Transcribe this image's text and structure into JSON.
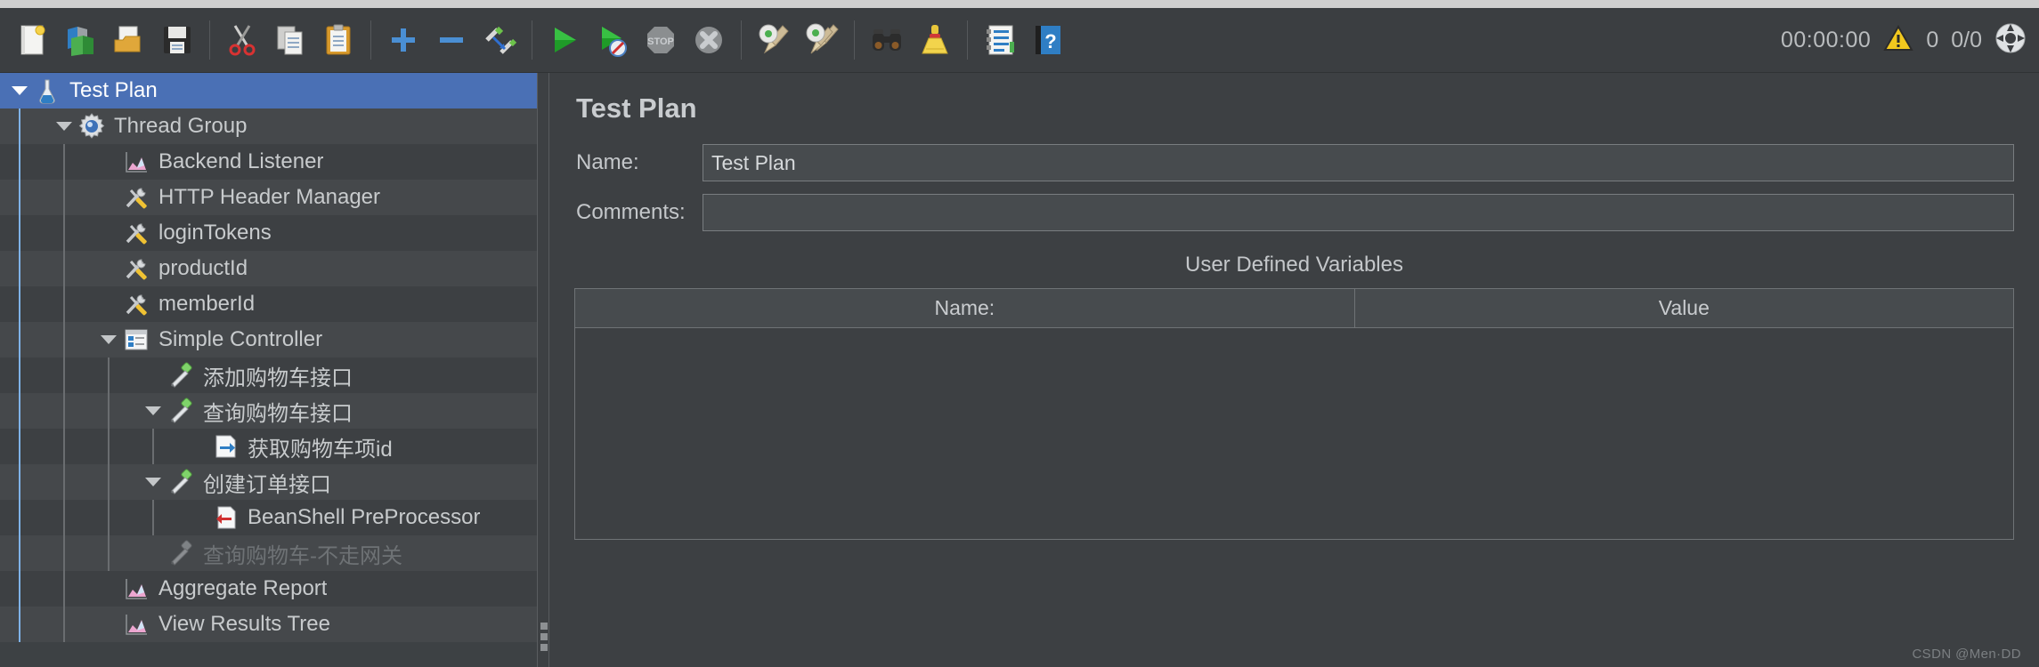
{
  "toolbar": {
    "buttons": [
      {
        "name": "new-button",
        "icon": "new-document-icon",
        "label": "New"
      },
      {
        "name": "templates-button",
        "icon": "templates-icon",
        "label": "Templates"
      },
      {
        "name": "open-button",
        "icon": "open-folder-icon",
        "label": "Open"
      },
      {
        "name": "save-button",
        "icon": "save-floppy-icon",
        "label": "Save Test Plan"
      },
      {
        "name": "cut-button",
        "icon": "scissors-icon",
        "label": "Cut"
      },
      {
        "name": "copy-button",
        "icon": "copy-pages-icon",
        "label": "Copy"
      },
      {
        "name": "paste-button",
        "icon": "clipboard-icon",
        "label": "Paste"
      },
      {
        "name": "expand-all-button",
        "icon": "plus-icon",
        "label": "Expand All"
      },
      {
        "name": "collapse-all-button",
        "icon": "minus-icon",
        "label": "Collapse All"
      },
      {
        "name": "toggle-button",
        "icon": "toggle-pencil-icon",
        "label": "Toggle"
      },
      {
        "name": "start-button",
        "icon": "green-play-icon",
        "label": "Start"
      },
      {
        "name": "start-no-pauses-button",
        "icon": "green-play-no-timers-icon",
        "label": "Start no pauses"
      },
      {
        "name": "stop-button",
        "icon": "stop-sign-icon",
        "label": "Stop"
      },
      {
        "name": "shutdown-button",
        "icon": "shutdown-x-icon",
        "label": "Shutdown"
      },
      {
        "name": "clear-button",
        "icon": "gear-broom-icon",
        "label": "Clear"
      },
      {
        "name": "clear-all-button",
        "icon": "gear-brooms-icon",
        "label": "Clear All"
      },
      {
        "name": "search-button",
        "icon": "binoculars-icon",
        "label": "Search"
      },
      {
        "name": "reset-search-button",
        "icon": "yellow-broom-icon",
        "label": "Reset Search"
      },
      {
        "name": "function-helper-button",
        "icon": "list-report-icon",
        "label": "Function Helper Dialog"
      },
      {
        "name": "help-button",
        "icon": "blue-help-book-icon",
        "label": "Help"
      }
    ],
    "status": {
      "timer": "00:00:00",
      "warning_icon": "warning-triangle-icon",
      "warning_count": "0",
      "threads": "0/0",
      "connection_icon": "connection-status-icon"
    }
  },
  "tree": {
    "items": [
      {
        "label": "Test Plan",
        "depth": 0,
        "icon": "test-plan-icon",
        "twisty": "down",
        "selected": true,
        "disabled": false
      },
      {
        "label": "Thread Group",
        "depth": 1,
        "icon": "thread-group-gear-icon",
        "twisty": "down",
        "selected": false,
        "disabled": false
      },
      {
        "label": "Backend Listener",
        "depth": 2,
        "icon": "listener-chart-icon",
        "twisty": "none",
        "selected": false,
        "disabled": false
      },
      {
        "label": "HTTP Header Manager",
        "depth": 2,
        "icon": "config-tools-icon",
        "twisty": "none",
        "selected": false,
        "disabled": false
      },
      {
        "label": "loginTokens",
        "depth": 2,
        "icon": "config-tools-icon",
        "twisty": "none",
        "selected": false,
        "disabled": false
      },
      {
        "label": "productId",
        "depth": 2,
        "icon": "config-tools-icon",
        "twisty": "none",
        "selected": false,
        "disabled": false
      },
      {
        "label": "memberId",
        "depth": 2,
        "icon": "config-tools-icon",
        "twisty": "none",
        "selected": false,
        "disabled": false
      },
      {
        "label": "Simple Controller",
        "depth": 2,
        "icon": "simple-controller-icon",
        "twisty": "down",
        "selected": false,
        "disabled": false
      },
      {
        "label": "添加购物车接口",
        "depth": 3,
        "icon": "http-sampler-pipette-icon",
        "twisty": "none",
        "selected": false,
        "disabled": false
      },
      {
        "label": "查询购物车接口",
        "depth": 3,
        "icon": "http-sampler-pipette-icon",
        "twisty": "down",
        "selected": false,
        "disabled": false
      },
      {
        "label": "获取购物车项id",
        "depth": 4,
        "icon": "post-processor-icon",
        "twisty": "none",
        "selected": false,
        "disabled": false
      },
      {
        "label": "创建订单接口",
        "depth": 3,
        "icon": "http-sampler-pipette-icon",
        "twisty": "down",
        "selected": false,
        "disabled": false
      },
      {
        "label": "BeanShell PreProcessor",
        "depth": 4,
        "icon": "pre-processor-icon",
        "twisty": "none",
        "selected": false,
        "disabled": false
      },
      {
        "label": "查询购物车-不走网关",
        "depth": 3,
        "icon": "http-sampler-pipette-icon",
        "twisty": "none",
        "selected": false,
        "disabled": true
      },
      {
        "label": "Aggregate Report",
        "depth": 2,
        "icon": "listener-chart-icon",
        "twisty": "none",
        "selected": false,
        "disabled": false
      },
      {
        "label": "View Results Tree",
        "depth": 2,
        "icon": "listener-chart-icon",
        "twisty": "none",
        "selected": false,
        "disabled": false
      }
    ]
  },
  "main": {
    "title": "Test Plan",
    "name_label": "Name:",
    "name_value": "Test Plan",
    "comments_label": "Comments:",
    "comments_value": "",
    "comments_placeholder": "",
    "udv_title": "User Defined Variables",
    "udv_columns": [
      "Name:",
      "Value"
    ],
    "udv_rows": []
  },
  "watermark": "CSDN @Men·DD",
  "colors": {
    "selection": "#4a70b5",
    "panel_bg": "#3d4043",
    "row_alt_bg": "#45484b",
    "text": "#c8cbcd",
    "disabled_text": "#6e7275",
    "accent_green": "#3c9a3c"
  }
}
